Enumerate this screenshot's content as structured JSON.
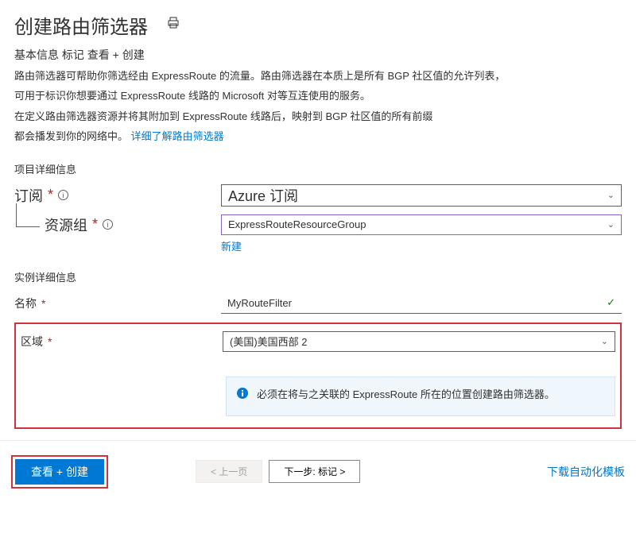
{
  "header": {
    "title": "创建路由筛选器"
  },
  "tabs": {
    "line": "基本信息 标记 查看 + 创建"
  },
  "desc": {
    "l1": "路由筛选器可帮助你筛选经由 ExpressRoute 的流量。路由筛选器在本质上是所有 BGP 社区值的允许列表，",
    "l2": "可用于标识你想要通过 ExpressRoute 线路的 Microsoft 对等互连使用的服务。",
    "l3": "在定义路由筛选器资源并将其附加到 ExpressRoute 线路后，映射到 BGP 社区值的所有前缀",
    "l4a": "都会播发到你的网络中。",
    "l4b": "详细了解路由筛选器"
  },
  "sections": {
    "project": "项目详细信息",
    "instance": "实例详细信息"
  },
  "fields": {
    "subscription": {
      "label": "订阅",
      "value": "Azure 订阅"
    },
    "resourceGroup": {
      "label": "资源组",
      "value": "ExpressRouteResourceGroup",
      "newLink": "新建"
    },
    "name": {
      "label": "名称",
      "value": "MyRouteFilter"
    },
    "region": {
      "label": "区域",
      "value": "(美国)美国西部 2"
    }
  },
  "info": {
    "text": "必须在将与之关联的 ExpressRoute 所在的位置创建路由筛选器。"
  },
  "footer": {
    "review": "查看 + 创建",
    "prev": "< 上一页",
    "next": "下一步: 标记 >",
    "download": "下载自动化模板"
  },
  "symbols": {
    "required": "*",
    "info": "i",
    "check": "✓",
    "chevron": "⌄"
  }
}
